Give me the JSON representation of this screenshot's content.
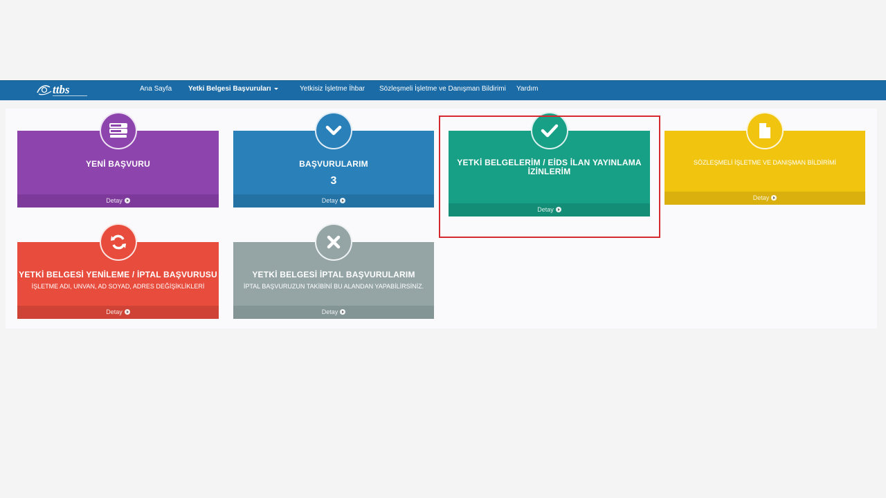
{
  "nav": {
    "logo_text": "ttbs",
    "items": [
      {
        "label": "Ana Sayfa"
      },
      {
        "label": "Yetki Belgesi Başvuruları"
      },
      {
        "label": "Yetkisiz İşletme İhbar"
      },
      {
        "label": "Sözleşmeli İşletme ve Danışman Bildirimi"
      },
      {
        "label": "Yardım"
      }
    ]
  },
  "tiles": {
    "yeni_basvuru": {
      "title": "YENİ BAŞVURU",
      "footer": "Detay",
      "color": "#8e44ad",
      "icon": "list-icon"
    },
    "basvurularim": {
      "title": "BAŞVURULARIM",
      "count": "3",
      "footer": "Detay",
      "color": "#2a80b9",
      "icon": "chevron-down-icon"
    },
    "yetki_belgelerim": {
      "title": "YETKİ BELGELERİM / EİDS İLAN YAYINLAMA İZİNLERİM",
      "footer": "Detay",
      "color": "#17a086",
      "icon": "check-icon"
    },
    "sozlesmeli": {
      "title": "SÖZLEŞMELİ İŞLETME VE DANIŞMAN BİLDİRİMİ",
      "footer": "Detay",
      "color": "#f1c40f",
      "icon": "document-icon"
    },
    "yenileme_iptal": {
      "title": "YETKİ BELGESİ YENİLEME / İPTAL BAŞVURUSU",
      "subtitle": "İŞLETME ADI, UNVAN, AD SOYAD, ADRES DEĞİŞİKLİKLERİ",
      "footer": "Detay",
      "color": "#e84c3d",
      "icon": "refresh-icon"
    },
    "iptal_basvurularim": {
      "title": "YETKİ BELGESİ İPTAL BAŞVURULARIM",
      "subtitle": "İPTAL BAŞVURUZUN TAKİBİNİ BU ALANDAN YAPABİLİRSİNİZ.",
      "footer": "Detay",
      "color": "#95a5a6",
      "icon": "close-icon"
    }
  }
}
